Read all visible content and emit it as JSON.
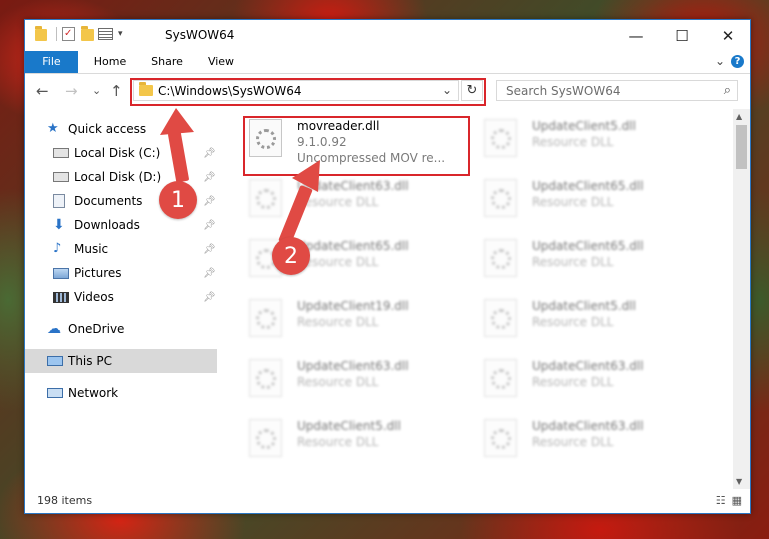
{
  "window": {
    "title": "SysWOW64",
    "controls": {
      "minimize": "—",
      "maximize": "☐",
      "close": "✕"
    }
  },
  "ribbon": {
    "tabs": [
      "File",
      "Home",
      "Share",
      "View"
    ],
    "expand": "⌄",
    "help": "?"
  },
  "nav": {
    "back": "←",
    "forward": "→",
    "recent": "⌄",
    "up": "↑",
    "address": "C:\\Windows\\SysWOW64",
    "address_chevron": "⌄",
    "refresh": "↻",
    "search_placeholder": "Search SysWOW64"
  },
  "sidebar": {
    "items": [
      {
        "label": "Quick access",
        "icon": "star-icon",
        "pinned": false
      },
      {
        "label": "Local Disk (C:)",
        "icon": "drive-icon",
        "pinned": true
      },
      {
        "label": "Local Disk (D:)",
        "icon": "drive-icon",
        "pinned": true
      },
      {
        "label": "Documents",
        "icon": "documents-icon",
        "pinned": true
      },
      {
        "label": "Downloads",
        "icon": "downloads-icon",
        "pinned": true
      },
      {
        "label": "Music",
        "icon": "music-icon",
        "pinned": true
      },
      {
        "label": "Pictures",
        "icon": "pictures-icon",
        "pinned": true
      },
      {
        "label": "Videos",
        "icon": "videos-icon",
        "pinned": true
      },
      {
        "label": "OneDrive",
        "icon": "cloud-icon",
        "pinned": false
      },
      {
        "label": "This PC",
        "icon": "computer-icon",
        "pinned": false,
        "selected": true
      },
      {
        "label": "Network",
        "icon": "network-icon",
        "pinned": false
      }
    ]
  },
  "files": {
    "focused": {
      "name": "movreader.dll",
      "version": "9.1.0.92",
      "description": "Uncompressed MOV re..."
    },
    "others": [
      {
        "name": "UpdateClient5.dll",
        "type": "Resource DLL"
      },
      {
        "name": "UpdateClient63.dll",
        "type": "Resource DLL"
      },
      {
        "name": "UpdateClient65.dll",
        "type": "Resource DLL"
      },
      {
        "name": "UpdateClient65.dll",
        "type": "Resource DLL"
      },
      {
        "name": "UpdateClient65.dll",
        "type": "Resource DLL"
      },
      {
        "name": "UpdateClient19.dll",
        "type": "Resource DLL"
      },
      {
        "name": "UpdateClient5.dll",
        "type": "Resource DLL"
      },
      {
        "name": "UpdateClient63.dll",
        "type": "Resource DLL"
      },
      {
        "name": "UpdateClient63.dll",
        "type": "Resource DLL"
      },
      {
        "name": "UpdateClient5.dll",
        "type": "Resource DLL"
      },
      {
        "name": "UpdateClient63.dll",
        "type": "Resource DLL"
      }
    ]
  },
  "status": {
    "item_count": "198 items"
  },
  "callouts": {
    "one": "1",
    "two": "2",
    "color": "#e04a44"
  }
}
